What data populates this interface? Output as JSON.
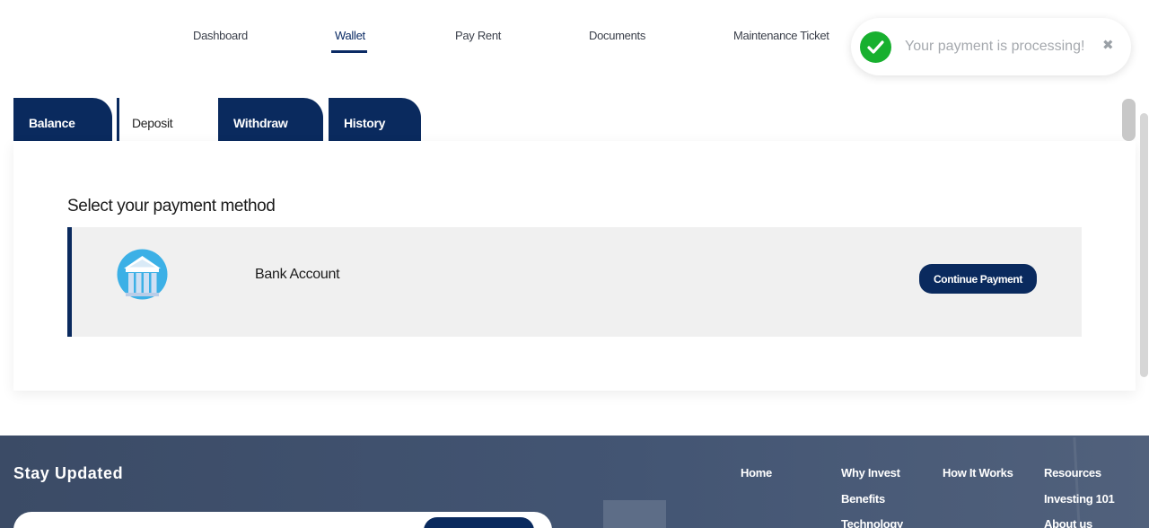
{
  "nav": {
    "items": [
      {
        "label": "Dashboard"
      },
      {
        "label": "Wallet"
      },
      {
        "label": "Pay Rent"
      },
      {
        "label": "Documents"
      },
      {
        "label": "Maintenance Ticket"
      }
    ],
    "active": "Wallet"
  },
  "toast": {
    "message": "Your payment is processing!",
    "close_glyph": "✖",
    "status_color": "#18b02f"
  },
  "tabs": [
    {
      "label": "Balance"
    },
    {
      "label": "Deposit"
    },
    {
      "label": "Withdraw"
    },
    {
      "label": "History"
    }
  ],
  "active_tab": "Deposit",
  "panel": {
    "title": "Select your payment method",
    "methods": [
      {
        "label": "Bank Account",
        "icon": "bank-icon",
        "action_label": "Continue Payment"
      }
    ]
  },
  "footer": {
    "title": "Stay Updated",
    "links": [
      {
        "label": "Home"
      },
      {
        "label": "Why Invest"
      },
      {
        "label": "Benefits"
      },
      {
        "label": "Technology"
      },
      {
        "label": "How It Works"
      },
      {
        "label": "Resources"
      },
      {
        "label": "Investing 101"
      },
      {
        "label": "About us"
      }
    ]
  },
  "colors": {
    "brand": "#0a2a5e",
    "success": "#18b02f"
  }
}
